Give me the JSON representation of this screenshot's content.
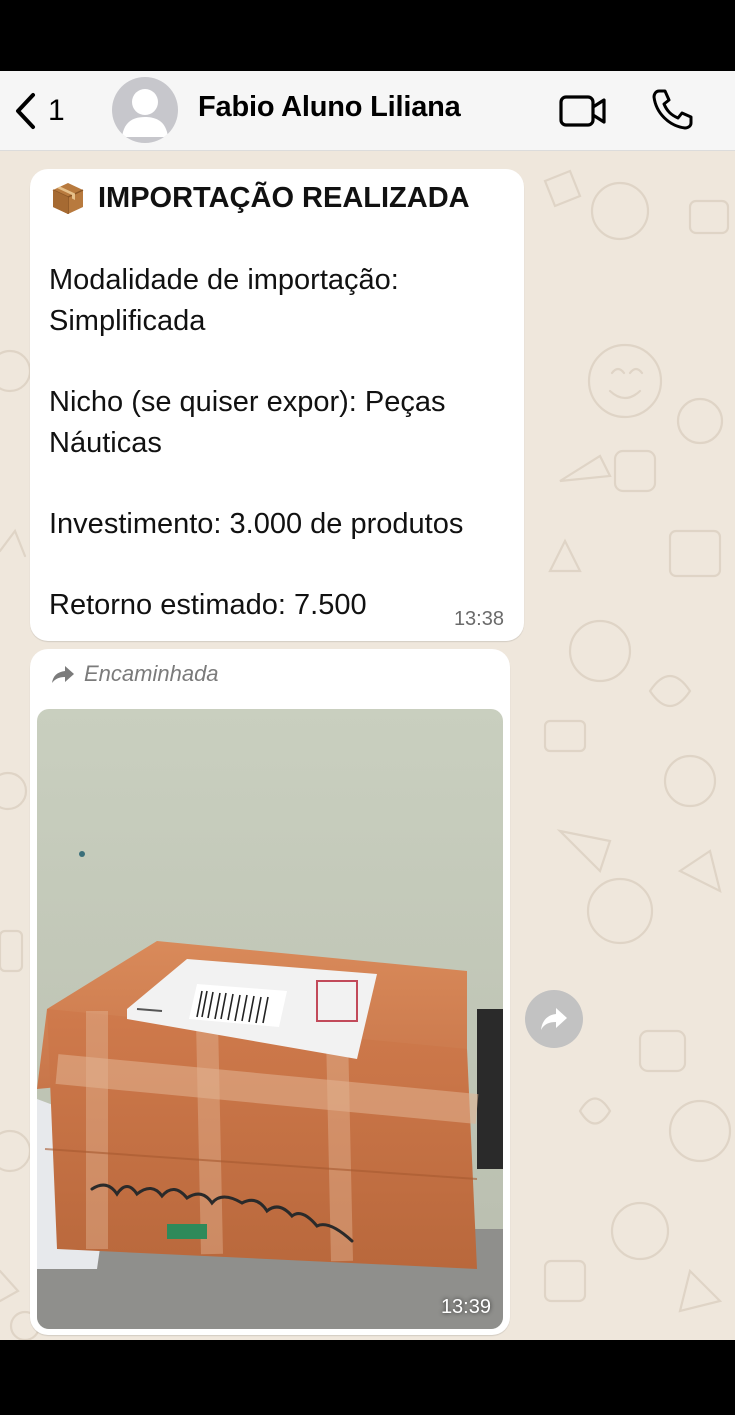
{
  "header": {
    "back_count": "1",
    "contact_name": "Fabio Aluno Liliana"
  },
  "message_text": {
    "title": "IMPORTAÇÃO REALIZADA",
    "lines": [
      "Modalidade de importação:",
      "Simplificada",
      "Nicho (se quiser expor): Peças",
      "Náuticas",
      "Investimento: 3.000 de produtos",
      "Retorno estimado: 7.500"
    ],
    "time": "13:38"
  },
  "message_media": {
    "forwarded_label": "Encaminhada",
    "time": "13:39"
  },
  "colors": {
    "chat_background": "#efe7dc",
    "bubble": "#ffffff",
    "header": "#f6f6f6"
  },
  "icons": [
    "chevron-left-icon",
    "avatar-placeholder-icon",
    "video-call-icon",
    "phone-icon",
    "package-icon",
    "forward-arrow-icon",
    "share-icon"
  ]
}
